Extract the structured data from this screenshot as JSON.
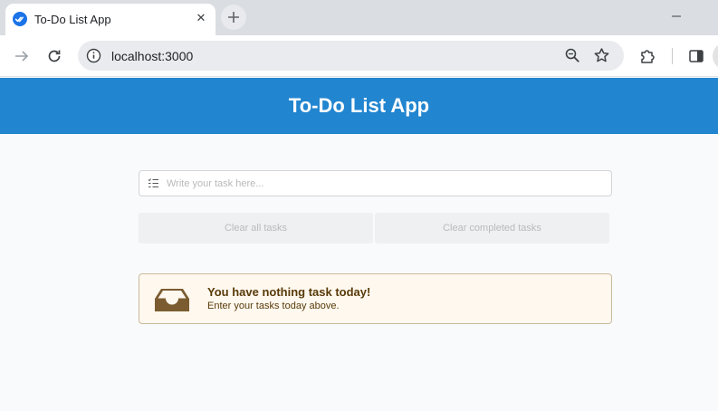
{
  "browser": {
    "tab": {
      "title": "To-Do List App",
      "favicon": "check-double-icon",
      "close_glyph": "✕"
    },
    "new_tab": "plus-icon",
    "address": {
      "url": "localhost:3000"
    },
    "icons": [
      "forward-arrow-icon",
      "reload-icon",
      "info-icon",
      "zoom-icon",
      "star-icon",
      "extensions-icon",
      "side-panel-icon",
      "minimize-icon"
    ]
  },
  "app": {
    "title": "To-Do List App",
    "input": {
      "placeholder": "Write your task here...",
      "value": ""
    },
    "buttons": {
      "clear_all": "Clear all tasks",
      "clear_completed": "Clear completed tasks"
    },
    "empty_message": {
      "header": "You have nothing task today!",
      "text": "Enter your tasks today above.",
      "icon": "inbox-icon"
    }
  },
  "colors": {
    "header_bg": "#2185d0",
    "header_text": "#ffffff",
    "button_bg": "#eef0f2",
    "message_bg": "#fff8ef",
    "message_text": "#573a08",
    "message_icon": "#7a5c30"
  }
}
